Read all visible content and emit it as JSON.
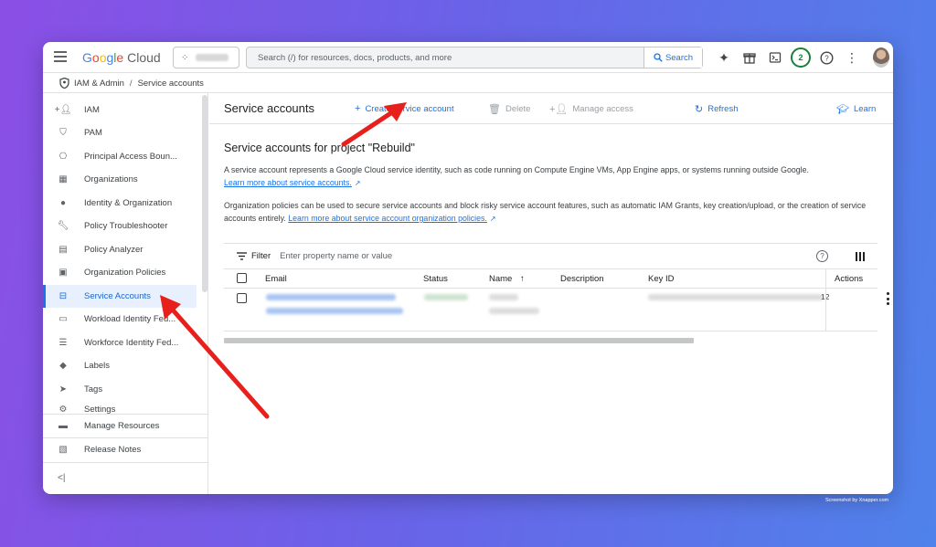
{
  "app": {
    "logo_google": "Google",
    "logo_cloud": "Cloud"
  },
  "topbar": {
    "search_placeholder": "Search (/) for resources, docs, products, and more",
    "search_button": "Search",
    "notification_count": "2"
  },
  "breadcrumb": {
    "section": "IAM & Admin",
    "page": "Service accounts"
  },
  "sidebar": {
    "items": [
      {
        "label": "IAM",
        "icon": "person-add-icon"
      },
      {
        "label": "PAM",
        "icon": "shield-icon"
      },
      {
        "label": "Principal Access Boun...",
        "icon": "policy-icon"
      },
      {
        "label": "Organizations",
        "icon": "building-icon"
      },
      {
        "label": "Identity & Organization",
        "icon": "account-circle-icon"
      },
      {
        "label": "Policy Troubleshooter",
        "icon": "wrench-icon"
      },
      {
        "label": "Policy Analyzer",
        "icon": "document-search-icon"
      },
      {
        "label": "Organization Policies",
        "icon": "list-box-icon"
      },
      {
        "label": "Service Accounts",
        "icon": "service-account-icon"
      },
      {
        "label": "Workload Identity Fed...",
        "icon": "id-card-icon"
      },
      {
        "label": "Workforce Identity Fed...",
        "icon": "list-icon"
      },
      {
        "label": "Labels",
        "icon": "label-icon"
      },
      {
        "label": "Tags",
        "icon": "tag-icon"
      },
      {
        "label": "Settings",
        "icon": "gear-icon"
      }
    ],
    "bottom": [
      {
        "label": "Manage Resources",
        "icon": "folder-gear-icon"
      },
      {
        "label": "Release Notes",
        "icon": "notes-icon"
      }
    ],
    "collapse": "<|"
  },
  "toolbar": {
    "title": "Service accounts",
    "create": "Create service account",
    "delete": "Delete",
    "manage_access": "Manage access",
    "refresh": "Refresh",
    "learn": "Learn"
  },
  "content": {
    "title": "Service accounts for project \"Rebuild\"",
    "para1_text": "A service account represents a Google Cloud service identity, such as code running on Compute Engine VMs, App Engine apps, or systems running outside Google.",
    "para1_link": "Learn more about service accounts.",
    "para2_text": "Organization policies can be used to secure service accounts and block risky service account features, such as automatic IAM Grants, key creation/upload, or the creation of service accounts entirely.",
    "para2_link": "Learn more about service account organization policies."
  },
  "table": {
    "filter_label": "Filter",
    "filter_placeholder": "Enter property name or value",
    "columns": [
      "Email",
      "Status",
      "Name",
      "Description",
      "Key ID",
      "Actions"
    ],
    "key_suffix": "12"
  },
  "colors": {
    "accent": "#1a73e8",
    "arrow": "#e8201c"
  },
  "watermark": "Screenshot by Xnapper.com"
}
